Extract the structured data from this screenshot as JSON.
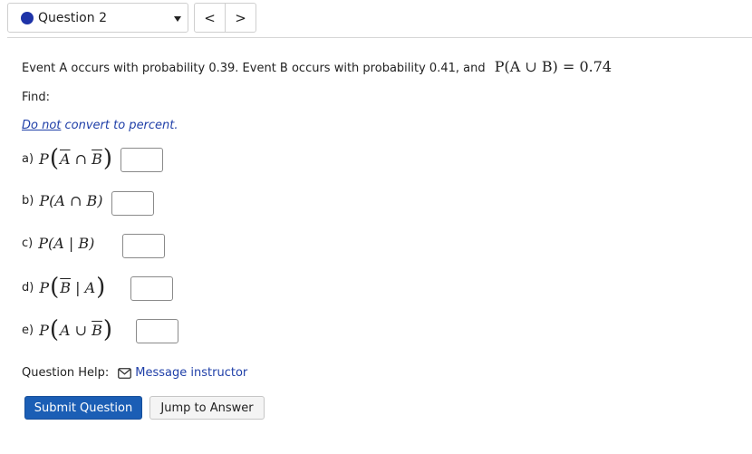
{
  "header": {
    "question_label": "Question 2",
    "prev_label": "<",
    "next_label": ">",
    "dot_color": "#1e33a8"
  },
  "problem": {
    "statement_text": "Event A occurs with probability 0.39. Event B occurs with probability 0.41, and",
    "given": "P(A ∪ B) = 0.74",
    "find_label": "Find:",
    "note_link": "Do not",
    "note_rest": " convert to percent."
  },
  "parts": [
    {
      "label": "a)",
      "value": ""
    },
    {
      "label": "b)",
      "value": ""
    },
    {
      "label": "c)",
      "value": ""
    },
    {
      "label": "d)",
      "value": ""
    },
    {
      "label": "e)",
      "value": ""
    }
  ],
  "help": {
    "label": "Question Help:",
    "icon": "mail-icon",
    "link": "Message instructor"
  },
  "buttons": {
    "submit": "Submit Question",
    "jump": "Jump to Answer",
    "submit_color": "#1b5eb5"
  }
}
